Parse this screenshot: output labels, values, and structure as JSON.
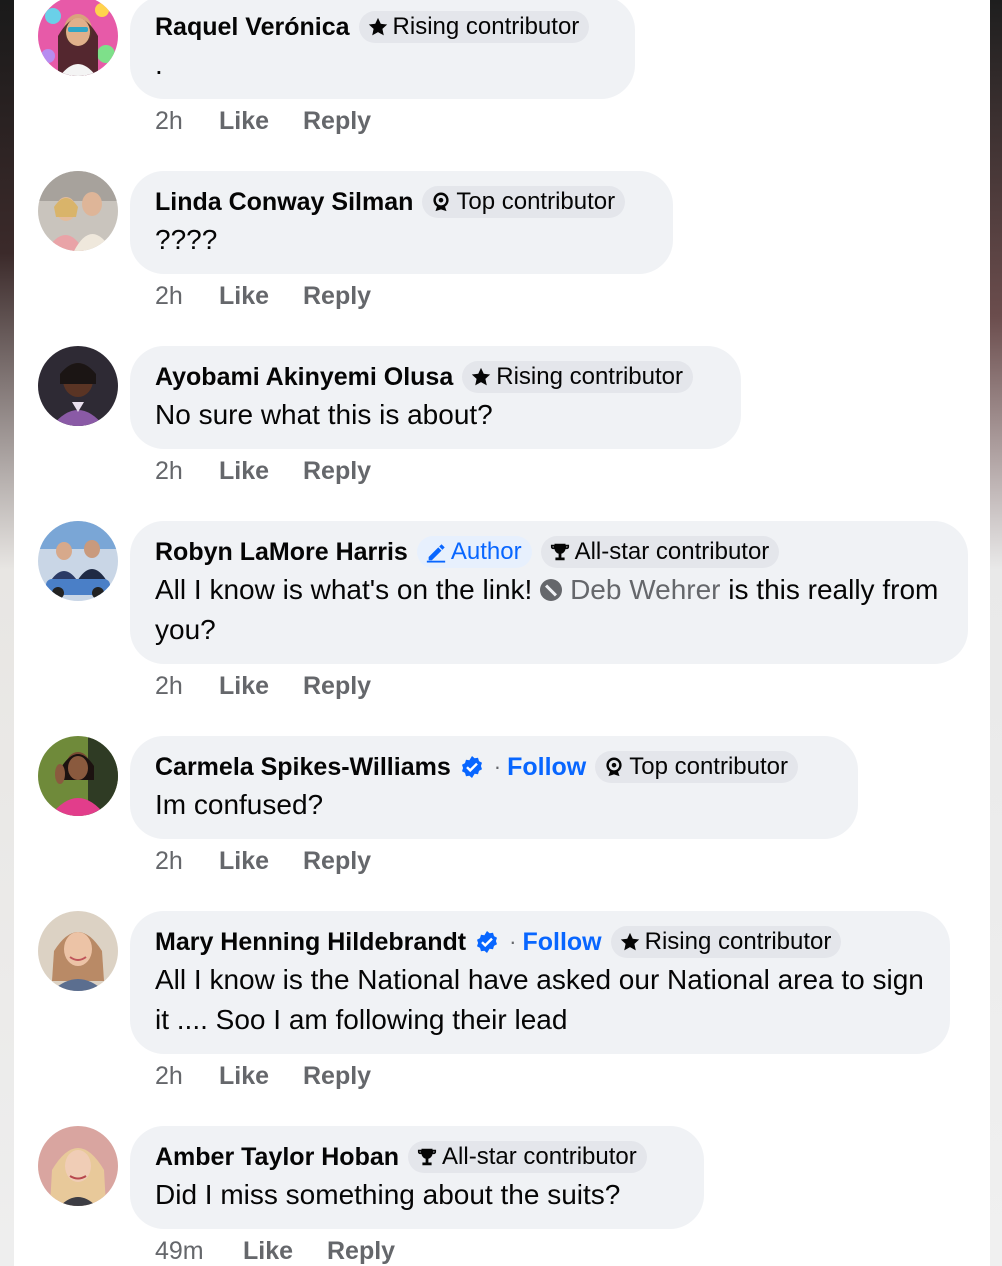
{
  "comments": [
    {
      "name": "Raquel Verónica",
      "verified": false,
      "follow": "",
      "author_badge": "",
      "badge": "Rising contributor",
      "badge_type": "star",
      "text": ".",
      "time": "2h",
      "like": "Like",
      "reply": "Reply",
      "avatar_colors": [
        "#e75aa8",
        "#6ad0e8"
      ]
    },
    {
      "name": "Linda Conway Silman",
      "verified": false,
      "follow": "",
      "author_badge": "",
      "badge": "Top contributor",
      "badge_type": "medal",
      "text": "????",
      "time": "2h",
      "like": "Like",
      "reply": "Reply",
      "avatar_colors": [
        "#c9c4bd",
        "#e9a3a7"
      ]
    },
    {
      "name": "Ayobami Akinyemi Olusa",
      "verified": false,
      "follow": "",
      "author_badge": "",
      "badge": "Rising contributor",
      "badge_type": "star",
      "text": "No sure what this is about?",
      "time": "2h",
      "like": "Like",
      "reply": "Reply",
      "avatar_colors": [
        "#3b2a26",
        "#8a5aa6"
      ]
    },
    {
      "name": "Robyn LaMore Harris",
      "verified": false,
      "follow": "",
      "author_badge": "Author",
      "badge": "All-star contributor",
      "badge_type": "trophy",
      "text_before": "All I know is what's on the link!",
      "mention": "Deb Wehrer",
      "text_after": "is this really from you?",
      "time": "2h",
      "like": "Like",
      "reply": "Reply",
      "avatar_colors": [
        "#4a7fc7",
        "#c9d6e6"
      ]
    },
    {
      "name": "Carmela Spikes-Williams",
      "verified": true,
      "separator": "·",
      "follow": "Follow",
      "author_badge": "",
      "badge": "Top contributor",
      "badge_type": "medal",
      "text": "Im confused?",
      "time": "2h",
      "like": "Like",
      "reply": "Reply",
      "avatar_colors": [
        "#e23d8b",
        "#6f8a3a"
      ]
    },
    {
      "name": "Mary Henning Hildebrandt",
      "verified": true,
      "separator": "·",
      "follow": "Follow",
      "author_badge": "",
      "badge": "Rising contributor",
      "badge_type": "star",
      "text": "All I know is the National have asked our National area to sign it .... Soo I am following their lead",
      "time": "2h",
      "like": "Like",
      "reply": "Reply",
      "avatar_colors": [
        "#b98a66",
        "#dcd2c4"
      ]
    },
    {
      "name": "Amber Taylor Hoban",
      "verified": false,
      "follow": "",
      "author_badge": "",
      "badge": "All-star contributor",
      "badge_type": "trophy",
      "text": "Did I miss something about the suits?",
      "time": "49m",
      "like": "Like",
      "reply": "Reply",
      "avatar_colors": [
        "#e8c99a",
        "#d9a5a0"
      ]
    }
  ],
  "colors": {
    "bubble": "#f0f2f5",
    "badge": "#e4e6eb",
    "link_blue": "#0866ff",
    "meta_gray": "#65676b"
  }
}
